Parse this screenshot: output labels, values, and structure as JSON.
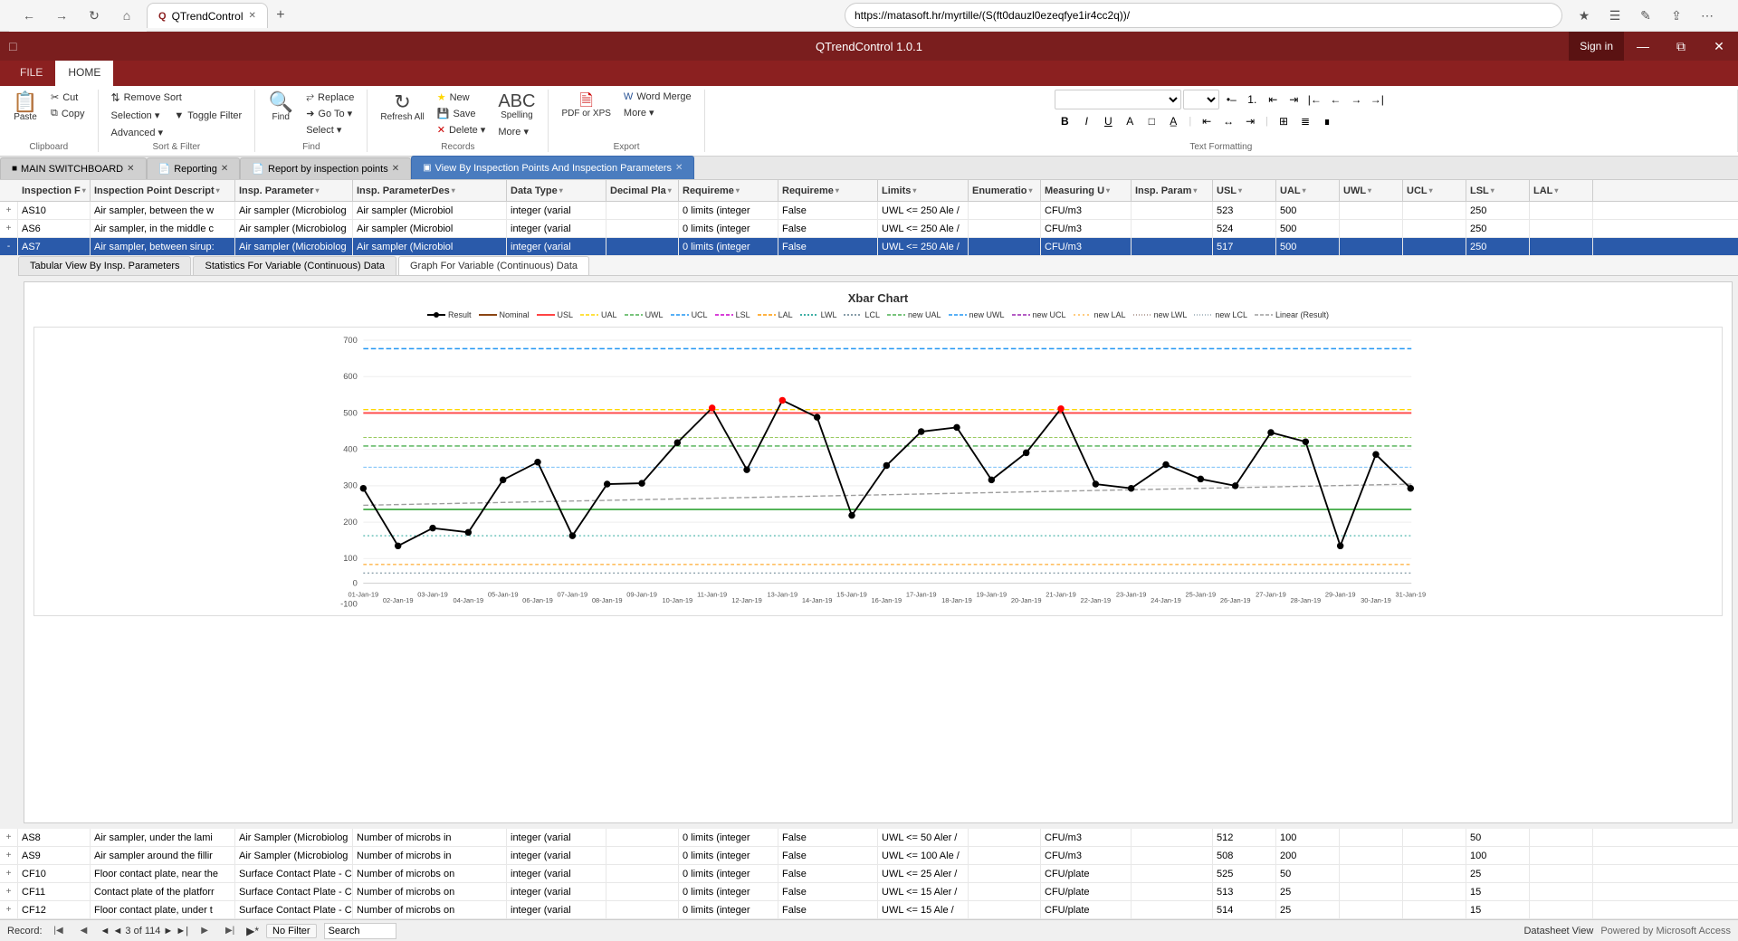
{
  "browser": {
    "tab_label": "QTrendControl",
    "url": "https://matasoft.hr/myrtille/(S(ft0dauzl0ezeqfye1ir4cc2q))/",
    "favicon": "Q"
  },
  "app": {
    "title": "QTrendControl 1.0.1",
    "sign_in_label": "Sign in"
  },
  "ribbon": {
    "tabs": [
      "FILE",
      "HOME"
    ],
    "active_tab": "HOME",
    "groups": {
      "clipboard": {
        "label": "Clipboard",
        "paste_label": "Paste",
        "cut_label": "Cut",
        "copy_label": "Copy"
      },
      "sort_filter": {
        "label": "Sort & Filter",
        "remove_sort_label": "Remove Sort",
        "selection_label": "Selection ▾",
        "toggle_filter_label": "Toggle Filter",
        "advanced_label": "Advanced ▾"
      },
      "find": {
        "label": "Find",
        "find_label": "Find",
        "replace_label": "Replace",
        "goto_label": "Go To ▾",
        "select_label": "Select ▾"
      },
      "records": {
        "label": "Records",
        "refresh_label": "Refresh All",
        "new_label": "New",
        "save_label": "Save",
        "delete_label": "Delete ▾",
        "more_label": "More ▾",
        "spelling_label": "Spelling"
      },
      "export": {
        "label": "Export",
        "pdf_label": "PDF or XPS",
        "word_merge_label": "Word Merge",
        "more_label": "More ▾"
      },
      "text_formatting": {
        "label": "Text Formatting",
        "bold_label": "B",
        "italic_label": "I",
        "underline_label": "U"
      }
    }
  },
  "doc_tabs": [
    {
      "label": "MAIN SWITCHBOARD",
      "active": false
    },
    {
      "label": "Reporting",
      "active": false
    },
    {
      "label": "Report by inspection points",
      "active": false
    },
    {
      "label": "View By Inspection Points And Inspection Parameters",
      "active": true
    }
  ],
  "table_columns": [
    "Inspection F▾",
    "Inspection Point Descript▾",
    "Insp. Parameter▾",
    "Insp. ParameterDes▾",
    "Data Type▾",
    "Decimal Pla▾",
    "Requireme▾",
    "Requireme▾",
    "Limits▾",
    "Enumeratio▾",
    "Measuring U▾",
    "Insp. Param▾",
    "USL▾",
    "UAL▾",
    "UWL▾",
    "UCL▾",
    "LSL▾",
    "LAL▾"
  ],
  "table_rows": [
    {
      "expand": "+",
      "insp_f": "AS10",
      "insp_desc": "Air sampler, between the w",
      "insp_param": "Air sampler (Microbiolog",
      "insp_param_desc": "Air sampler (Microbiol",
      "data_type": "integer (varial",
      "decimal": "",
      "req": "0 limits (integer",
      "req2": "False",
      "limits": "UWL <= 250 Ale /",
      "enum": "",
      "meas": "CFU/m3",
      "insp_param2": "",
      "usl": "523",
      "ual": "500",
      "uwl": "",
      "ucl": "",
      "lsl": "250",
      "lal": "",
      "selected": false
    },
    {
      "expand": "+",
      "insp_f": "AS6",
      "insp_desc": "Air sampler, in the middle c",
      "insp_param": "Air sampler (Microbiolog",
      "insp_param_desc": "Air sampler (Microbiol",
      "data_type": "integer (varial",
      "decimal": "",
      "req": "0 limits (integer",
      "req2": "False",
      "limits": "UWL <= 250 Ale /",
      "enum": "",
      "meas": "CFU/m3",
      "insp_param2": "",
      "usl": "524",
      "ual": "500",
      "uwl": "",
      "ucl": "",
      "lsl": "250",
      "lal": "",
      "selected": false
    },
    {
      "expand": "-",
      "insp_f": "AS7",
      "insp_desc": "Air sampler, between sirup:",
      "insp_param": "Air sampler (Microbiolog",
      "insp_param_desc": "Air sampler (Microbiol",
      "data_type": "integer (varial",
      "decimal": "",
      "req": "0 limits (integer",
      "req2": "False",
      "limits": "UWL <= 250 Ale /",
      "enum": "",
      "meas": "CFU/m3",
      "insp_param2": "",
      "usl": "517",
      "ual": "500",
      "uwl": "",
      "ucl": "",
      "lsl": "250",
      "lal": "",
      "selected": true
    }
  ],
  "sub_tabs": [
    "Tabular View By Insp. Parameters",
    "Statistics For Variable (Continuous) Data",
    "Graph For Variable (Continuous) Data"
  ],
  "active_sub_tab": "Graph For Variable (Continuous) Data",
  "chart": {
    "title": "Xbar Chart",
    "legend": [
      {
        "label": "Result",
        "style": "line-dot",
        "color": "#000"
      },
      {
        "label": "Nominal",
        "style": "line",
        "color": "#8b4513"
      },
      {
        "label": "USL",
        "style": "line",
        "color": "#ff4444"
      },
      {
        "label": "UAL",
        "style": "dashed",
        "color": "#ffd700"
      },
      {
        "label": "UWL",
        "style": "dashed",
        "color": "#4caf50"
      },
      {
        "label": "UCL",
        "style": "dashed",
        "color": "#2196f3"
      },
      {
        "label": "LSL",
        "style": "dashed",
        "color": "#9c27b0"
      },
      {
        "label": "LAL",
        "style": "dashed",
        "color": "#ff9800"
      },
      {
        "label": "LWL",
        "style": "dashed-dot",
        "color": "#009688"
      },
      {
        "label": "LCL",
        "style": "dashed-dot",
        "color": "#607d8b"
      },
      {
        "label": "new UAL",
        "style": "dashed",
        "color": "#4caf50"
      },
      {
        "label": "new UWL",
        "style": "dashed",
        "color": "#2196f3"
      },
      {
        "label": "new UCL",
        "style": "dashed",
        "color": "#9c27b0"
      },
      {
        "label": "new LAL",
        "style": "dashed-dot",
        "color": "#ff9800"
      },
      {
        "label": "new LWL",
        "style": "dotted",
        "color": "#795548"
      },
      {
        "label": "new LCL",
        "style": "dotted",
        "color": "#607d8b"
      },
      {
        "label": "Linear (Result)",
        "style": "dashed",
        "color": "#9e9e9e"
      }
    ],
    "x_labels": [
      "01-Jan-19",
      "02-Jan-19",
      "03-Jan-19",
      "04-Jan-19",
      "05-Jan-19",
      "06-Jan-19",
      "07-Jan-19",
      "08-Jan-19",
      "09-Jan-19",
      "10-Jan-19",
      "11-Jan-19",
      "12-Jan-19",
      "13-Jan-19",
      "14-Jan-19",
      "15-Jan-19",
      "16-Jan-19",
      "17-Jan-19",
      "18-Jan-19",
      "19-Jan-19",
      "20-Jan-19",
      "21-Jan-19",
      "22-Jan-19",
      "23-Jan-19",
      "24-Jan-19",
      "25-Jan-19",
      "26-Jan-19",
      "27-Jan-19",
      "28-Jan-19",
      "29-Jan-19",
      "30-Jan-19",
      "31-Jan-19"
    ],
    "y_axis": [
      700,
      600,
      500,
      400,
      300,
      200,
      100,
      0,
      -100
    ],
    "data_points": [
      240,
      120,
      170,
      155,
      295,
      355,
      130,
      260,
      265,
      420,
      520,
      310,
      560,
      480,
      195,
      330,
      455,
      470,
      295,
      390,
      510,
      265,
      250,
      340,
      280,
      255,
      450,
      410,
      120,
      380,
      250
    ]
  },
  "bottom_rows": [
    {
      "expand": "+",
      "insp_f": "AS8",
      "insp_desc": "Air sampler, under the lami",
      "insp_param": "Air Sampler (Microbiolog",
      "insp_param_desc": "Number of microbs in",
      "data_type": "integer (varial",
      "decimal": "",
      "req": "0 limits (integer",
      "req2": "False",
      "limits": "UWL <= 50 Aler /",
      "enum": "",
      "meas": "CFU/m3",
      "insp_param2": "",
      "usl": "512",
      "ual": "100",
      "uwl": "",
      "ucl": "",
      "lsl": "50",
      "lal": ""
    },
    {
      "expand": "+",
      "insp_f": "AS9",
      "insp_desc": "Air sampler around the fillir",
      "insp_param": "Air Sampler (Microbiolog",
      "insp_param_desc": "Number of microbs in",
      "data_type": "integer (varial",
      "decimal": "",
      "req": "0 limits (integer",
      "req2": "False",
      "limits": "UWL <= 100 Ale /",
      "enum": "",
      "meas": "CFU/m3",
      "insp_param2": "",
      "usl": "508",
      "ual": "200",
      "uwl": "",
      "ucl": "",
      "lsl": "100",
      "lal": ""
    },
    {
      "expand": "+",
      "insp_f": "CF10",
      "insp_desc": "Floor contact plate, near the",
      "insp_param": "Surface Contact Plate - C",
      "insp_param_desc": "Number of microbs on",
      "data_type": "integer (varial",
      "decimal": "",
      "req": "0 limits (integer",
      "req2": "False",
      "limits": "UWL <= 25 Aler /",
      "enum": "",
      "meas": "CFU/plate",
      "insp_param2": "",
      "usl": "525",
      "ual": "50",
      "uwl": "",
      "ucl": "",
      "lsl": "25",
      "lal": ""
    },
    {
      "expand": "+",
      "insp_f": "CF11",
      "insp_desc": "Contact plate of the platforr",
      "insp_param": "Surface Contact Plate - C",
      "insp_param_desc": "Number of microbs on",
      "data_type": "integer (varial",
      "decimal": "",
      "req": "0 limits (integer",
      "req2": "False",
      "limits": "UWL <= 15 Aler /",
      "enum": "",
      "meas": "CFU/plate",
      "insp_param2": "",
      "usl": "513",
      "ual": "25",
      "uwl": "",
      "ucl": "",
      "lsl": "15",
      "lal": ""
    },
    {
      "expand": "+",
      "insp_f": "CF12",
      "insp_desc": "Floor contact plate, under t",
      "insp_param": "Surface Contact Plate - C",
      "insp_param_desc": "Number of microbs on",
      "data_type": "integer (varial",
      "decimal": "",
      "req": "0 limits (integer",
      "req2": "False",
      "limits": "UWL <= 15 Ale /",
      "enum": "",
      "meas": "CFU/plate",
      "insp_param2": "",
      "usl": "514",
      "ual": "25",
      "uwl": "",
      "ucl": "",
      "lsl": "15",
      "lal": ""
    }
  ],
  "status_bar": {
    "record_label": "Record:",
    "record_info": "◄ ◄  3 of 114  ► ►|",
    "filter_label": "No Filter",
    "search_label": "Search",
    "view_label": "Datasheet View",
    "powered_by": "Powered by Microsoft Access"
  },
  "window_controls": {
    "minimize": "─",
    "restore": "❐",
    "close": "✕"
  }
}
